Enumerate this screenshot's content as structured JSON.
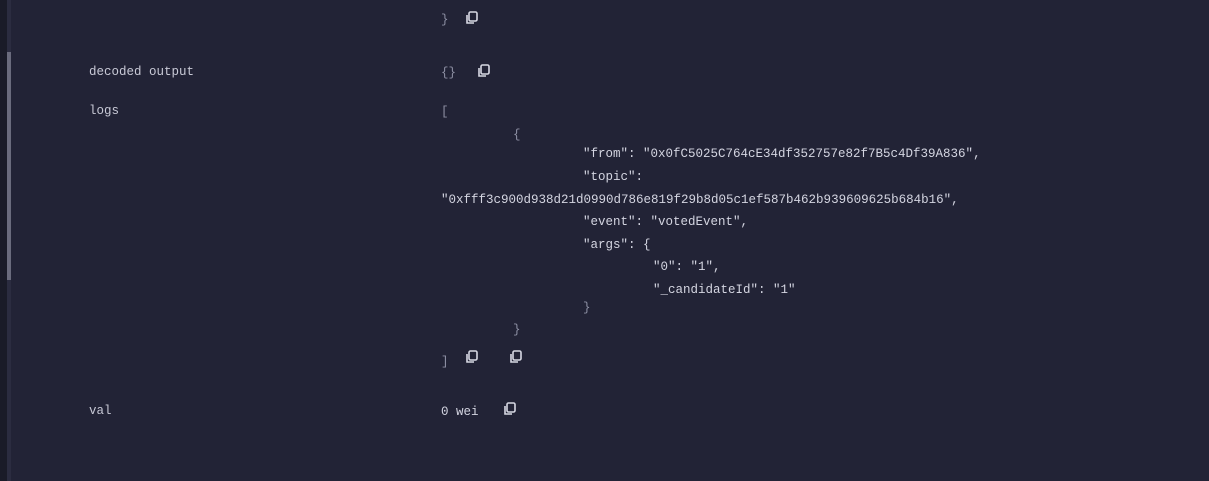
{
  "top_row": {
    "closing_brace": "}"
  },
  "decoded_output": {
    "label": "decoded output",
    "value": "{}"
  },
  "logs": {
    "label": "logs",
    "open_bracket": "[",
    "open_brace": "{",
    "line_from": "\"from\": \"0x0fC5025C764cE34df352757e82f7B5c4Df39A836\",",
    "line_topic_key": "\"topic\":",
    "line_topic_value": "\"0xfff3c900d938d21d0990d786e819f29b8d05c1ef587b462b939609625b684b16\",",
    "line_event": "\"event\": \"votedEvent\",",
    "line_args_key": "\"args\": {",
    "line_arg_0": "\"0\": \"1\",",
    "line_arg_candidate": "\"_candidateId\": \"1\"",
    "close_args": "}",
    "close_brace": "}",
    "close_bracket": "]"
  },
  "val": {
    "label": "val",
    "value": "0 wei"
  },
  "icons": {
    "copy": "copy-icon"
  }
}
